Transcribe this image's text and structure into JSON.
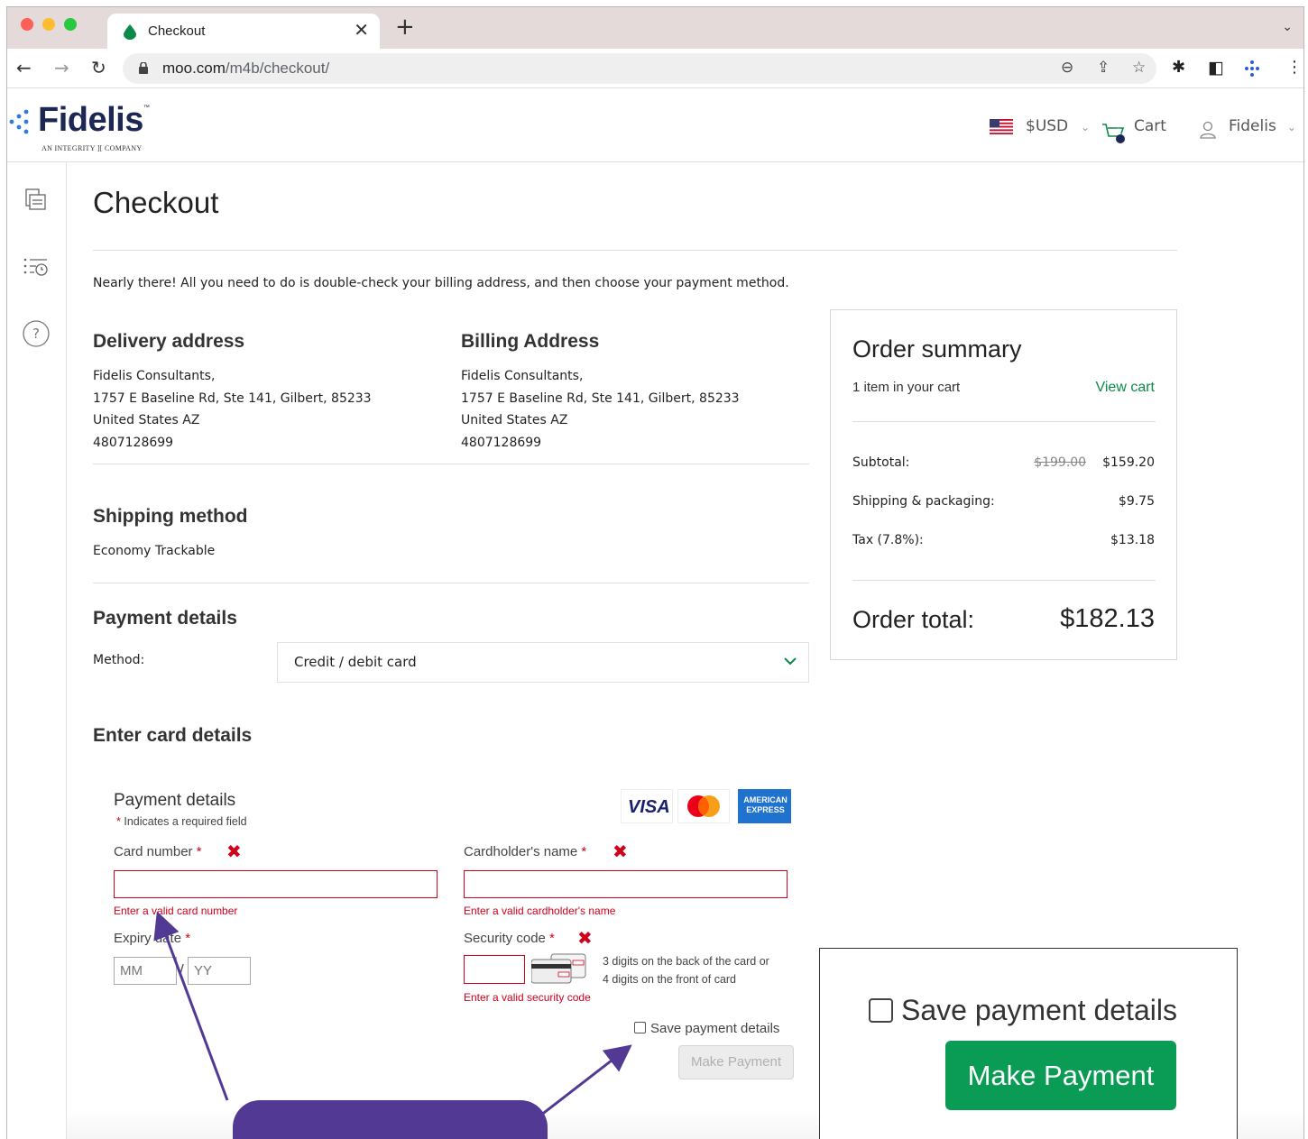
{
  "browser": {
    "tab_title": "Checkout",
    "tab_close": "✕",
    "new_tab": "+",
    "tab_menu": "⌄",
    "url_host": "moo.com",
    "url_path": "/m4b/checkout/",
    "icons": [
      "back-icon",
      "forward-icon",
      "reload-icon",
      "lock-icon",
      "zoom-icon",
      "share-icon",
      "bookmark-star-icon",
      "extensions-icon",
      "sidepanel-icon",
      "extension-dots-icon",
      "menu-icon"
    ]
  },
  "header": {
    "logo_text": "Fidelis",
    "logo_tm": "™",
    "logo_subtitle": "AN INTEGRITY ][ COMPANY",
    "currency": "$USD",
    "cart_label": "Cart",
    "cart_count": "1",
    "user_label": "Fidelis"
  },
  "page": {
    "title": "Checkout",
    "intro": "Nearly there! All you need to do is double-check your billing address, and then choose your payment method."
  },
  "delivery": {
    "heading": "Delivery address",
    "lines": [
      "Fidelis Consultants,",
      "1757 E Baseline Rd, Ste 141, Gilbert, 85233",
      "United States AZ",
      "4807128699"
    ]
  },
  "billing": {
    "heading": "Billing Address",
    "lines": [
      "Fidelis Consultants,",
      "1757 E Baseline Rd, Ste 141, Gilbert, 85233",
      "United States AZ",
      "4807128699"
    ]
  },
  "shipping": {
    "heading": "Shipping method",
    "value": "Economy Trackable"
  },
  "payment": {
    "heading": "Payment details",
    "method_label": "Method:",
    "method_value": "Credit / debit card"
  },
  "card_form": {
    "heading": "Enter card details",
    "sub_heading": "Payment details",
    "required_note": "Indicates a required field",
    "card_number_label": "Card number",
    "card_number_error": "Enter a valid card number",
    "cardholder_label": "Cardholder's name",
    "cardholder_error": "Enter a valid cardholder's name",
    "expiry_label": "Expiry date",
    "expiry_mm_placeholder": "MM",
    "expiry_yy_placeholder": "YY",
    "expiry_separator": "/",
    "security_label": "Security code",
    "security_hint_1": "3 digits on the back of the card or",
    "security_hint_2": "4 digits on the front of card",
    "security_error": "Enter a valid security code",
    "save_label": "Save payment details",
    "submit_label": "Make Payment",
    "card_brands": [
      "VISA",
      "Mastercard",
      "AMERICAN EXPRESS"
    ]
  },
  "summary": {
    "title": "Order summary",
    "items": "1 item in your cart",
    "view_cart": "View cart",
    "subtotal_label": "Subtotal:",
    "subtotal_old": "$199.00",
    "subtotal": "$159.20",
    "shipping_label": "Shipping & packaging:",
    "shipping": "$9.75",
    "tax_label": "Tax (7.8%):",
    "tax": "$13.18",
    "total_label": "Order total:",
    "total": "$182.13"
  },
  "zoom_callout": {
    "save_label": "Save payment details",
    "button_label": "Make Payment"
  },
  "colors": {
    "brand_navy": "#1d2754",
    "accent_green": "#0a9c55",
    "error_red": "#d0021b",
    "annotation_purple": "#523a94"
  }
}
